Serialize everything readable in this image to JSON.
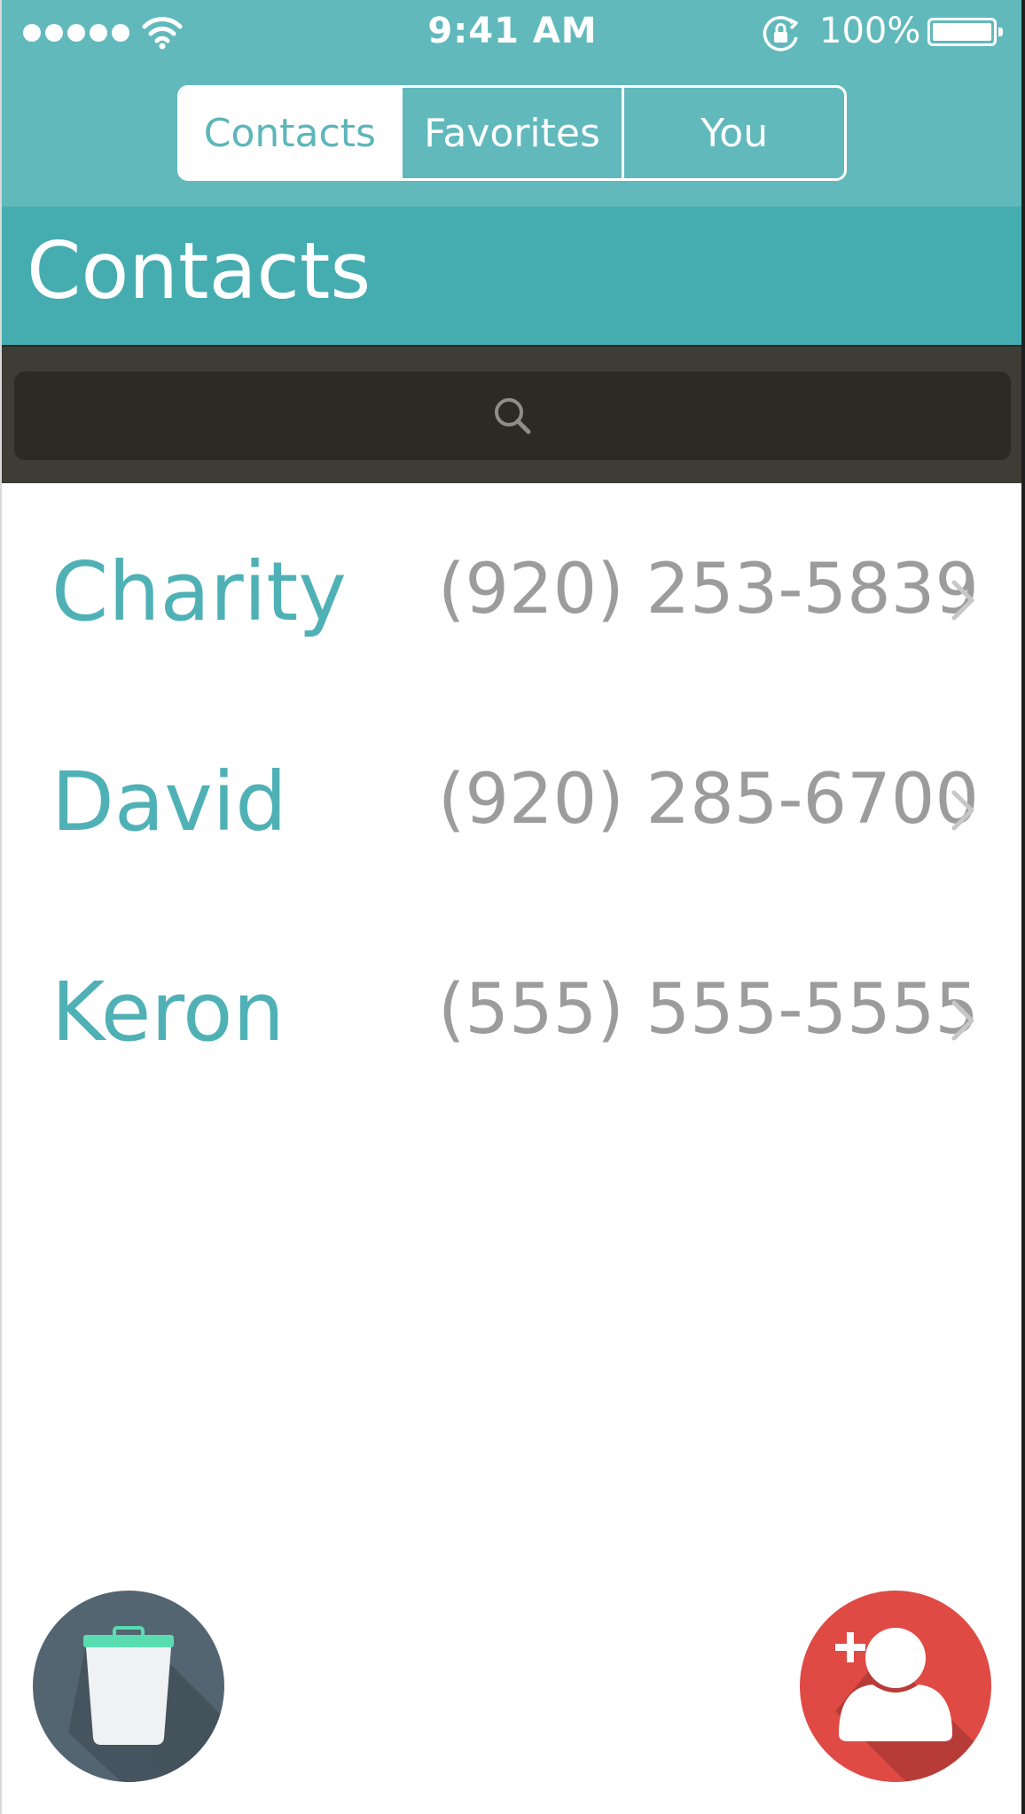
{
  "status_bar": {
    "time": "9:41 AM",
    "battery_percent": "100%",
    "signal_icon": "signal-dots-icon",
    "wifi_icon": "wifi-icon",
    "rotation_lock_icon": "rotation-lock-icon",
    "battery_icon": "battery-full-icon"
  },
  "segments": [
    {
      "label": "Contacts",
      "active": true
    },
    {
      "label": "Favorites",
      "active": false
    },
    {
      "label": "You",
      "active": false
    }
  ],
  "title": "Contacts",
  "search": {
    "icon": "search-icon",
    "placeholder": ""
  },
  "contacts": [
    {
      "name": "Charity",
      "phone": "(920) 253-5839"
    },
    {
      "name": "David",
      "phone": "(920) 285-6700"
    },
    {
      "name": "Keron",
      "phone": "(555) 555-5555"
    }
  ],
  "actions": {
    "delete_icon": "trash-icon",
    "add_icon": "add-contact-icon"
  },
  "colors": {
    "header_teal": "#61b9bc",
    "title_teal": "#45adb0",
    "name_teal": "#4fb1b5",
    "search_bg": "#3d3c35",
    "phone_gray": "#9c9c9c",
    "trash_button": "#536570",
    "add_button": "#df4a44",
    "trash_lid": "#58dcb0"
  }
}
